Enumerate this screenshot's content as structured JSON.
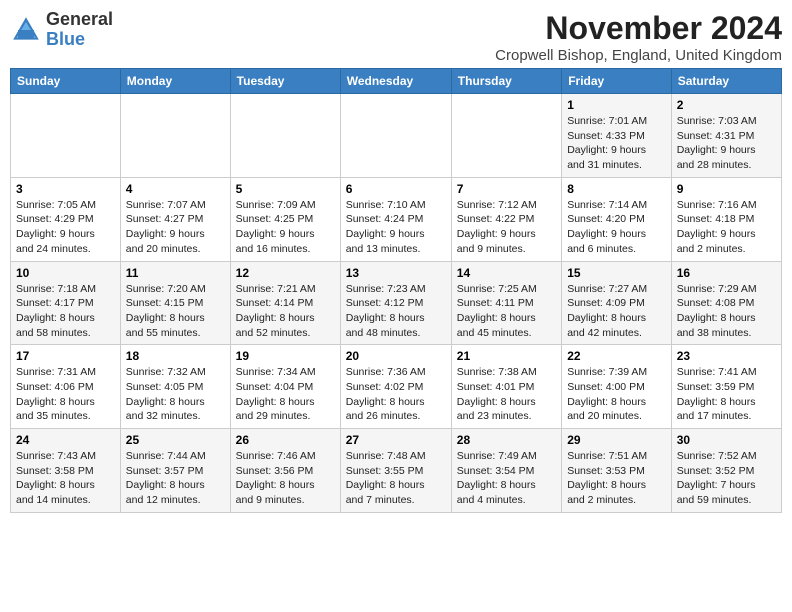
{
  "header": {
    "logo_general": "General",
    "logo_blue": "Blue",
    "month_title": "November 2024",
    "location": "Cropwell Bishop, England, United Kingdom"
  },
  "days_of_week": [
    "Sunday",
    "Monday",
    "Tuesday",
    "Wednesday",
    "Thursday",
    "Friday",
    "Saturday"
  ],
  "weeks": [
    [
      {
        "day": "",
        "info": ""
      },
      {
        "day": "",
        "info": ""
      },
      {
        "day": "",
        "info": ""
      },
      {
        "day": "",
        "info": ""
      },
      {
        "day": "",
        "info": ""
      },
      {
        "day": "1",
        "info": "Sunrise: 7:01 AM\nSunset: 4:33 PM\nDaylight: 9 hours\nand 31 minutes."
      },
      {
        "day": "2",
        "info": "Sunrise: 7:03 AM\nSunset: 4:31 PM\nDaylight: 9 hours\nand 28 minutes."
      }
    ],
    [
      {
        "day": "3",
        "info": "Sunrise: 7:05 AM\nSunset: 4:29 PM\nDaylight: 9 hours\nand 24 minutes."
      },
      {
        "day": "4",
        "info": "Sunrise: 7:07 AM\nSunset: 4:27 PM\nDaylight: 9 hours\nand 20 minutes."
      },
      {
        "day": "5",
        "info": "Sunrise: 7:09 AM\nSunset: 4:25 PM\nDaylight: 9 hours\nand 16 minutes."
      },
      {
        "day": "6",
        "info": "Sunrise: 7:10 AM\nSunset: 4:24 PM\nDaylight: 9 hours\nand 13 minutes."
      },
      {
        "day": "7",
        "info": "Sunrise: 7:12 AM\nSunset: 4:22 PM\nDaylight: 9 hours\nand 9 minutes."
      },
      {
        "day": "8",
        "info": "Sunrise: 7:14 AM\nSunset: 4:20 PM\nDaylight: 9 hours\nand 6 minutes."
      },
      {
        "day": "9",
        "info": "Sunrise: 7:16 AM\nSunset: 4:18 PM\nDaylight: 9 hours\nand 2 minutes."
      }
    ],
    [
      {
        "day": "10",
        "info": "Sunrise: 7:18 AM\nSunset: 4:17 PM\nDaylight: 8 hours\nand 58 minutes."
      },
      {
        "day": "11",
        "info": "Sunrise: 7:20 AM\nSunset: 4:15 PM\nDaylight: 8 hours\nand 55 minutes."
      },
      {
        "day": "12",
        "info": "Sunrise: 7:21 AM\nSunset: 4:14 PM\nDaylight: 8 hours\nand 52 minutes."
      },
      {
        "day": "13",
        "info": "Sunrise: 7:23 AM\nSunset: 4:12 PM\nDaylight: 8 hours\nand 48 minutes."
      },
      {
        "day": "14",
        "info": "Sunrise: 7:25 AM\nSunset: 4:11 PM\nDaylight: 8 hours\nand 45 minutes."
      },
      {
        "day": "15",
        "info": "Sunrise: 7:27 AM\nSunset: 4:09 PM\nDaylight: 8 hours\nand 42 minutes."
      },
      {
        "day": "16",
        "info": "Sunrise: 7:29 AM\nSunset: 4:08 PM\nDaylight: 8 hours\nand 38 minutes."
      }
    ],
    [
      {
        "day": "17",
        "info": "Sunrise: 7:31 AM\nSunset: 4:06 PM\nDaylight: 8 hours\nand 35 minutes."
      },
      {
        "day": "18",
        "info": "Sunrise: 7:32 AM\nSunset: 4:05 PM\nDaylight: 8 hours\nand 32 minutes."
      },
      {
        "day": "19",
        "info": "Sunrise: 7:34 AM\nSunset: 4:04 PM\nDaylight: 8 hours\nand 29 minutes."
      },
      {
        "day": "20",
        "info": "Sunrise: 7:36 AM\nSunset: 4:02 PM\nDaylight: 8 hours\nand 26 minutes."
      },
      {
        "day": "21",
        "info": "Sunrise: 7:38 AM\nSunset: 4:01 PM\nDaylight: 8 hours\nand 23 minutes."
      },
      {
        "day": "22",
        "info": "Sunrise: 7:39 AM\nSunset: 4:00 PM\nDaylight: 8 hours\nand 20 minutes."
      },
      {
        "day": "23",
        "info": "Sunrise: 7:41 AM\nSunset: 3:59 PM\nDaylight: 8 hours\nand 17 minutes."
      }
    ],
    [
      {
        "day": "24",
        "info": "Sunrise: 7:43 AM\nSunset: 3:58 PM\nDaylight: 8 hours\nand 14 minutes."
      },
      {
        "day": "25",
        "info": "Sunrise: 7:44 AM\nSunset: 3:57 PM\nDaylight: 8 hours\nand 12 minutes."
      },
      {
        "day": "26",
        "info": "Sunrise: 7:46 AM\nSunset: 3:56 PM\nDaylight: 8 hours\nand 9 minutes."
      },
      {
        "day": "27",
        "info": "Sunrise: 7:48 AM\nSunset: 3:55 PM\nDaylight: 8 hours\nand 7 minutes."
      },
      {
        "day": "28",
        "info": "Sunrise: 7:49 AM\nSunset: 3:54 PM\nDaylight: 8 hours\nand 4 minutes."
      },
      {
        "day": "29",
        "info": "Sunrise: 7:51 AM\nSunset: 3:53 PM\nDaylight: 8 hours\nand 2 minutes."
      },
      {
        "day": "30",
        "info": "Sunrise: 7:52 AM\nSunset: 3:52 PM\nDaylight: 7 hours\nand 59 minutes."
      }
    ]
  ]
}
